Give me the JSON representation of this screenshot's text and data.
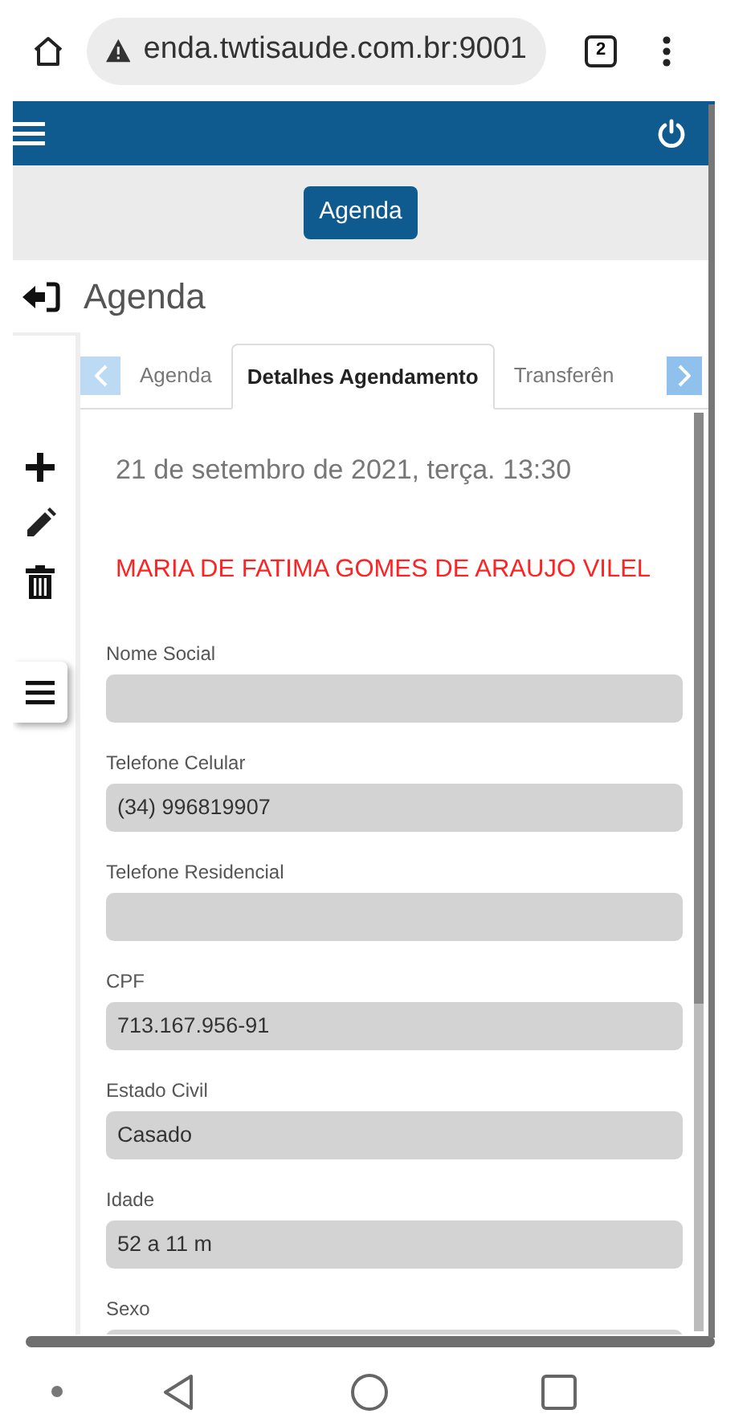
{
  "browser": {
    "url": "enda.twtisaude.com.br:9001",
    "tab_count": "2"
  },
  "toolbar_button": "Agenda",
  "page_title": "Agenda",
  "tabs": [
    {
      "label": "Agenda",
      "selected": false
    },
    {
      "label": "Detalhes Agendamento",
      "selected": true
    },
    {
      "label": "Transferên",
      "selected": false
    }
  ],
  "appointment_date": "21 de setembro de 2021, terça. 13:30",
  "patient_name": "MARIA DE FATIMA GOMES DE ARAUJO VILEL",
  "fields": [
    {
      "label": "Nome Social"
    },
    {
      "label": "Telefone Celular",
      "value": "(34) 996819907"
    },
    {
      "label": "Telefone Residencial"
    },
    {
      "label": "CPF",
      "value": "713.167.956-91"
    },
    {
      "label": "Estado Civil",
      "value": "Casado"
    },
    {
      "label": "Idade",
      "value": "52 a 11 m"
    },
    {
      "label": "Sexo"
    }
  ]
}
